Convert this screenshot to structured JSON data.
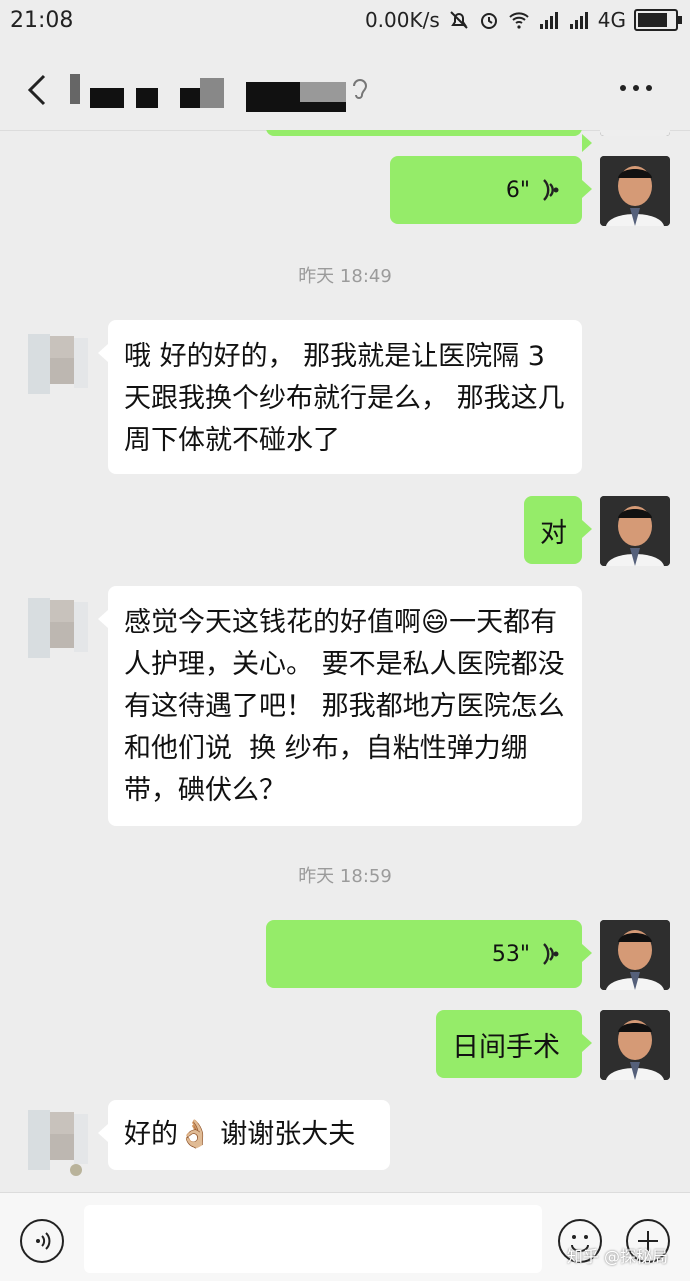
{
  "status_bar": {
    "time": "21:08",
    "network_speed": "0.00K/s",
    "network_type": "4G",
    "battery_percent": 90,
    "icons": [
      "mute-icon",
      "alarm-icon",
      "wifi-icon",
      "signal-icon",
      "signal-icon",
      "battery-icon"
    ]
  },
  "header": {
    "icons": [
      "back-icon",
      "ear-icon",
      "more-icon"
    ]
  },
  "messages": [
    {
      "type": "voice",
      "side": "right",
      "duration": "6\""
    },
    {
      "type": "timestamp",
      "text": "昨天 18:49"
    },
    {
      "type": "text",
      "side": "left",
      "text": "哦 好的好的， 那我就是让医院隔 3 天跟我换个纱布就行是么， 那我这几周下体就不碰水了"
    },
    {
      "type": "text",
      "side": "right",
      "text": "对"
    },
    {
      "type": "text",
      "side": "left",
      "text": "感觉今天这钱花的好值啊😄一天都有人护理，关心。 要不是私人医院都没有这待遇了吧！ 那我都地方医院怎么和他们说  换 纱布，自粘性弹力绷带，碘伏么？"
    },
    {
      "type": "timestamp",
      "text": "昨天 18:59"
    },
    {
      "type": "voice",
      "side": "right",
      "duration": "53\""
    },
    {
      "type": "text",
      "side": "right",
      "text": "日间手术"
    },
    {
      "type": "text",
      "side": "left",
      "text": "好的👌🏼 谢谢张大夫"
    }
  ],
  "input_bar": {
    "icons": [
      "voice-input-icon",
      "emoji-icon",
      "plus-icon"
    ],
    "input_value": ""
  },
  "watermark": "知乎 @探秘局",
  "colors": {
    "background": "#ededed",
    "sent_bubble": "#95ec69",
    "received_bubble": "#ffffff",
    "timestamp": "#9b9b9b"
  }
}
